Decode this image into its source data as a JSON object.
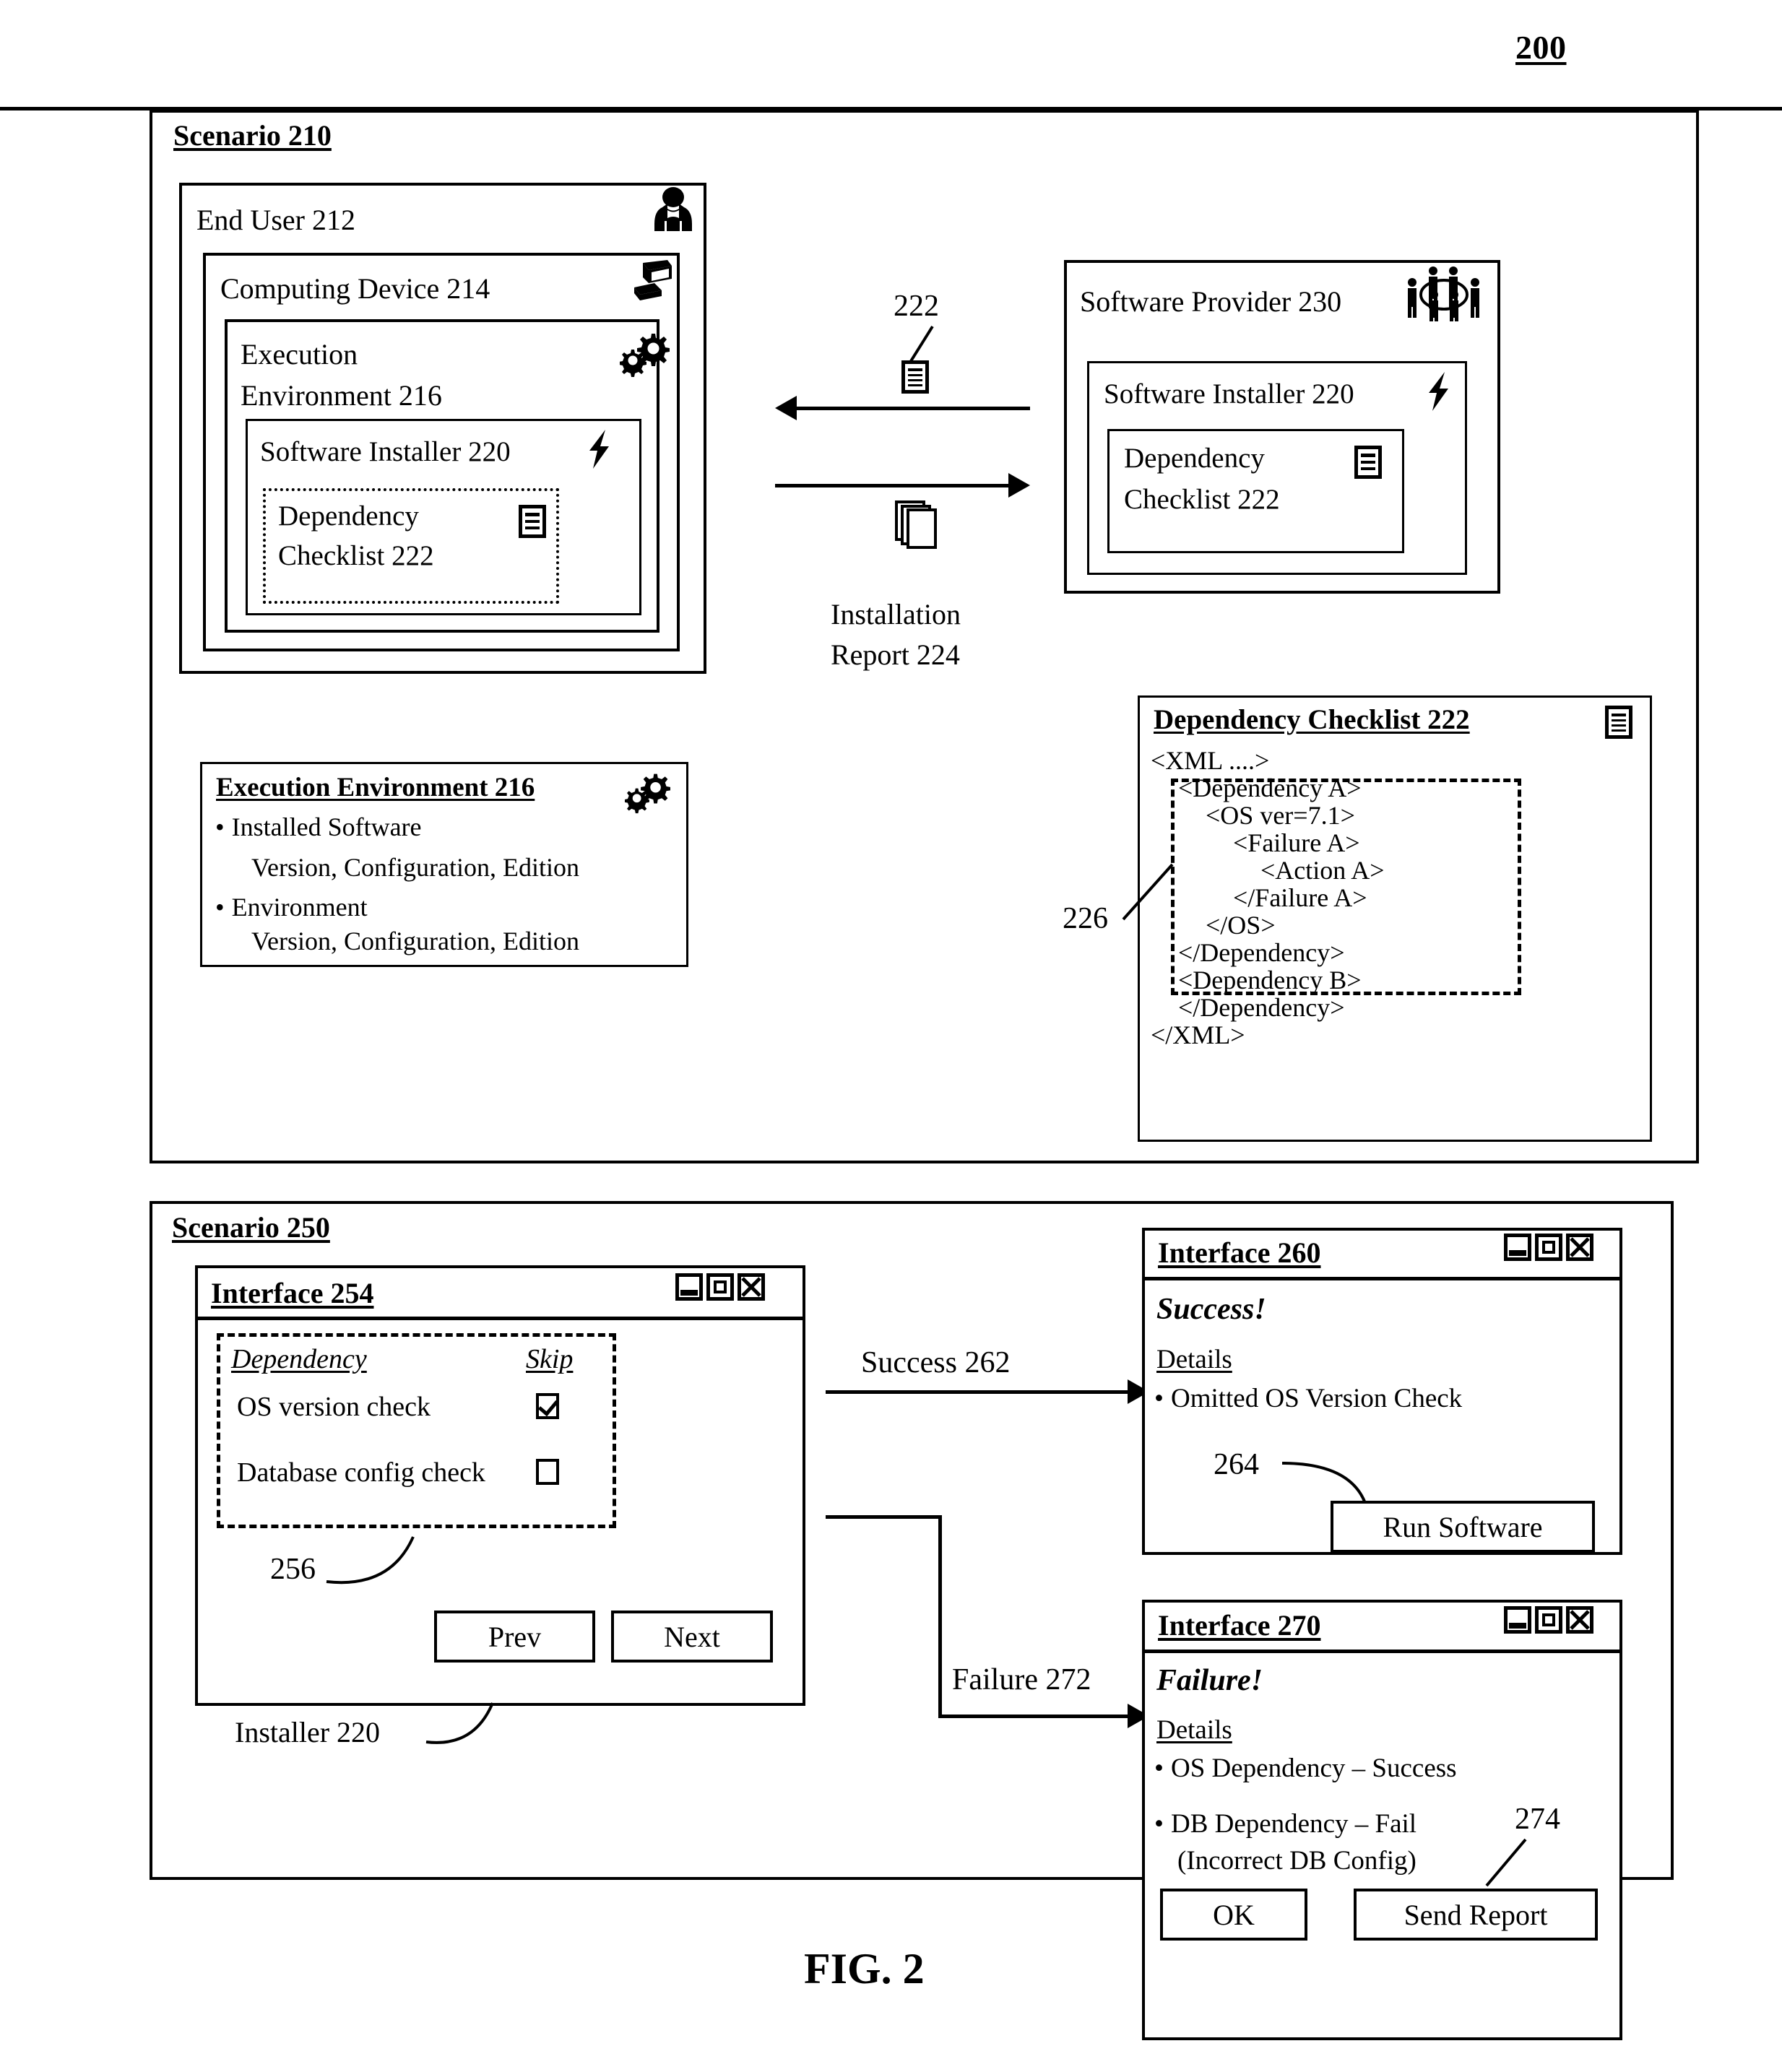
{
  "figure": {
    "number_top_right": "200",
    "caption": "FIG. 2"
  },
  "scenario_210": {
    "title": "Scenario 210",
    "end_user": {
      "title": "End User 212",
      "icon": "person-icon"
    },
    "computing_device": {
      "title": "Computing Device 214",
      "icon": "computer-icon"
    },
    "execution_environment": {
      "title_line1": "Execution",
      "title_line2": "Environment 216",
      "icon": "gears-icon"
    },
    "software_installer": {
      "title": "Software Installer 220",
      "icon": "lightning-bolt-icon"
    },
    "dependency_checklist_inner": {
      "title_line1": "Dependency",
      "title_line2": "Checklist 222",
      "icon": "checklist-document-icon"
    },
    "transfer": {
      "checklist_ref": "222",
      "checklist_icon": "checklist-document-icon",
      "report_icon": "stacked-pages-icon",
      "report_label_line1": "Installation",
      "report_label_line2": "Report 224"
    },
    "software_provider": {
      "title": "Software Provider 230",
      "icon": "people-group-icon",
      "installer_title": "Software Installer 220",
      "installer_icon": "lightning-bolt-icon",
      "checklist_line1": "Dependency",
      "checklist_line2": "Checklist 222",
      "checklist_icon": "checklist-document-icon"
    },
    "execution_environment_detail": {
      "title": "Execution Environment 216",
      "icon": "gears-icon",
      "bullets": [
        {
          "label": "Installed Software",
          "sub": "Version, Configuration, Edition"
        },
        {
          "label": "Environment",
          "sub": "Version, Configuration, Edition"
        }
      ]
    },
    "dependency_checklist_detail": {
      "title": "Dependency Checklist 222",
      "icon": "checklist-document-icon",
      "callout_ref": "226",
      "xml_lines": [
        {
          "text": "<XML ....>",
          "indent": 0,
          "highlighted": false
        },
        {
          "text": "<Dependency A>",
          "indent": 1,
          "highlighted": true
        },
        {
          "text": "<OS ver=7.1>",
          "indent": 2,
          "highlighted": true
        },
        {
          "text": "<Failure A>",
          "indent": 3,
          "highlighted": true
        },
        {
          "text": "<Action A>",
          "indent": 4,
          "highlighted": true
        },
        {
          "text": "</Failure A>",
          "indent": 3,
          "highlighted": true
        },
        {
          "text": "</OS>",
          "indent": 2,
          "highlighted": true
        },
        {
          "text": "</Dependency>",
          "indent": 1,
          "highlighted": true
        },
        {
          "text": "<Dependency B>",
          "indent": 1,
          "highlighted": false
        },
        {
          "text": "</Dependency>",
          "indent": 1,
          "highlighted": false
        },
        {
          "text": "</XML>",
          "indent": 0,
          "highlighted": false
        }
      ]
    }
  },
  "scenario_250": {
    "title": "Scenario 250",
    "interface_254": {
      "title": "Interface 254",
      "window_controls": [
        "minimize-icon",
        "maximize-icon",
        "close-icon"
      ],
      "table": {
        "col_dependency": "Dependency",
        "col_skip": "Skip",
        "rows": [
          {
            "name": "OS version check",
            "skip_checked": true
          },
          {
            "name": "Database config check",
            "skip_checked": false
          }
        ]
      },
      "callout_ref": "256",
      "buttons": {
        "prev": "Prev",
        "next": "Next"
      },
      "caption_ref": "Installer 220"
    },
    "edges": {
      "success": "Success 262",
      "failure": "Failure 272"
    },
    "interface_260": {
      "title": "Interface 260",
      "window_controls": [
        "minimize-icon",
        "maximize-icon",
        "close-icon"
      ],
      "status": "Success!",
      "details_heading": "Details",
      "details": [
        "Omitted OS Version Check"
      ],
      "callout_ref": "264",
      "buttons": {
        "run": "Run Software"
      }
    },
    "interface_270": {
      "title": "Interface 270",
      "window_controls": [
        "minimize-icon",
        "maximize-icon",
        "close-icon"
      ],
      "status": "Failure!",
      "details_heading": "Details",
      "details": [
        "OS Dependency  – Success",
        "DB Dependency  – Fail"
      ],
      "details_sub": "(Incorrect DB Config)",
      "callout_ref": "274",
      "buttons": {
        "ok": "OK",
        "send_report": "Send Report"
      }
    }
  }
}
